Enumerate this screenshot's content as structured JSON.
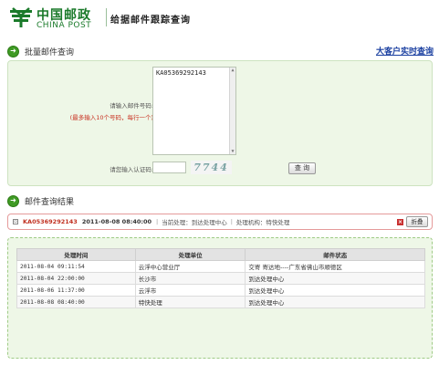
{
  "header": {
    "logo_cn": "中国邮政",
    "logo_en": "CHINA POST",
    "title": "给据邮件跟踪查询"
  },
  "batch": {
    "title": "批量邮件查询",
    "vip_link": "大客户实时查询",
    "number_label": "请输入邮件号码:",
    "number_tip": "(最多输入10个号码，每行一个)",
    "number_value": "KA05369292143",
    "code_label": "请您输入认证码:",
    "code_value": "",
    "captcha_text": "7744",
    "query_button": "查 询"
  },
  "results": {
    "title": "邮件查询结果",
    "summary": {
      "mail_no": "KA05369292143",
      "time": "2011-08-08 08:40:00",
      "status": "当前处理：到达处理中心",
      "sep": "|",
      "office": "处理机构：特快处理",
      "collapse_button": "折叠"
    },
    "table": {
      "headers": [
        "处理时间",
        "处理单位",
        "邮件状态"
      ],
      "rows": [
        [
          "2011-08-04 09:11:54",
          "云浮中心营业厅",
          "交寄  寄达地----广东省佛山市顺德区"
        ],
        [
          "2011-08-04 22:00:00",
          "长沙市",
          "到达处理中心"
        ],
        [
          "2011-08-06 11:37:00",
          "云浮市",
          "到达处理中心"
        ],
        [
          "2011-08-08 08:40:00",
          "特快处理",
          "到达处理中心"
        ]
      ]
    }
  },
  "colors": {
    "brand_green": "#1a7a2a",
    "panel_bg": "#eef7e7",
    "accent_red": "#c03020",
    "link_blue": "#1a3fa0"
  }
}
